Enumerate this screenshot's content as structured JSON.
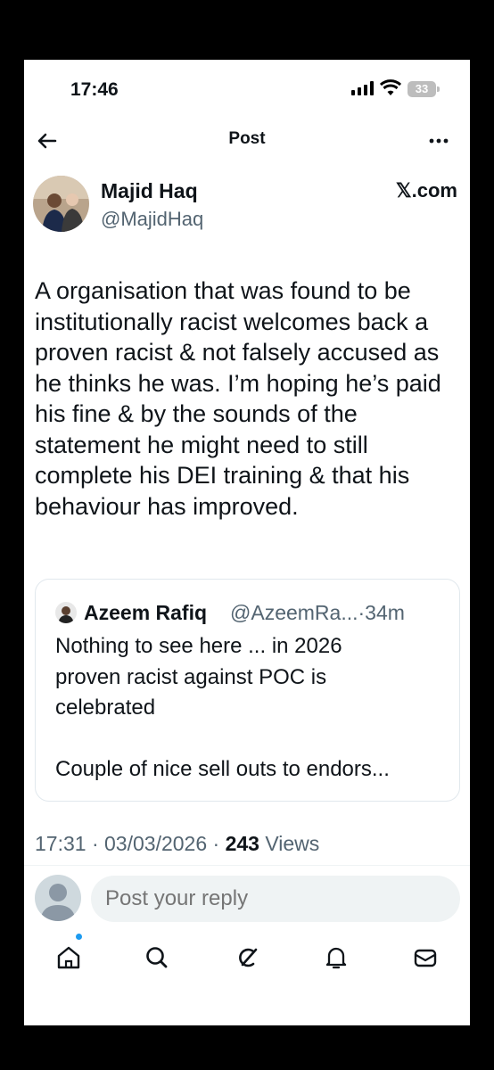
{
  "status_bar": {
    "time": "17:46",
    "battery": "33"
  },
  "nav": {
    "title": "Post"
  },
  "post": {
    "author_name": "Majid Haq",
    "author_handle": "@MajidHaq",
    "source": "𝕏.com",
    "body": "A organisation that was found to be institutionally racist welcomes back a proven racist & not falsely accused as he thinks he was. I’m hoping he’s paid his fine & by the sounds of the statement he might need to still complete his DEI training & that his behaviour has improved.",
    "time": "17:31",
    "date": "03/03/2026",
    "views_count": "243",
    "views_label": "Views"
  },
  "quote": {
    "name": "Azeem Rafiq",
    "handle_time": "@AzeemRa...·34m",
    "text_line1": "Nothing to see here ... in 2026",
    "text_line2": "proven racist against POC is",
    "text_line3": "celebrated",
    "text_line4": "Couple of nice sell outs to endors..."
  },
  "reply": {
    "placeholder": "Post your reply"
  },
  "tabbar": {
    "icons": [
      "home-icon",
      "search-icon",
      "grok-icon",
      "notifications-icon",
      "messages-icon"
    ],
    "accent": "#1d9bf0"
  }
}
